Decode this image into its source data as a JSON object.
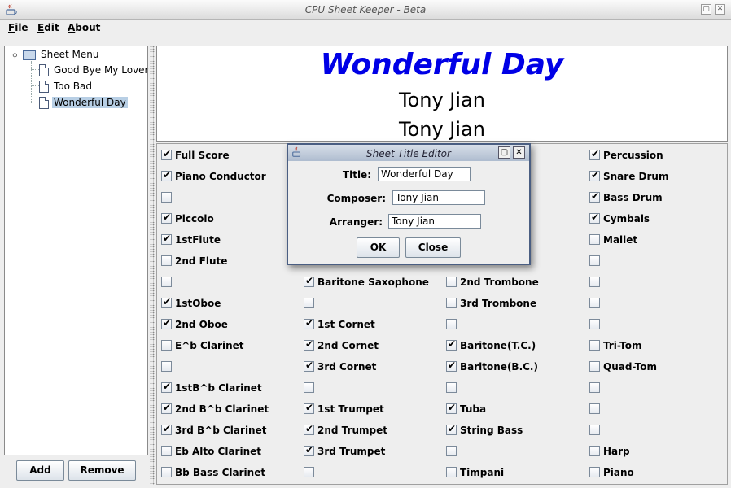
{
  "window": {
    "title": "CPU Sheet Keeper - Beta"
  },
  "menubar": {
    "file": "File",
    "edit": "Edit",
    "about": "About"
  },
  "tree": {
    "root": "Sheet Menu",
    "items": [
      "Good Bye My Lover",
      "Too Bad",
      "Wonderful Day"
    ],
    "selected_index": 2
  },
  "buttons": {
    "add": "Add",
    "remove": "Remove"
  },
  "header": {
    "title": "Wonderful Day",
    "composer": "Tony Jian",
    "arranger": "Tony Jian",
    "title_color": "#0000e6"
  },
  "parts": {
    "col1": [
      {
        "label": "Full Score",
        "checked": true
      },
      {
        "label": "Piano Conductor",
        "checked": true
      },
      {
        "label": "",
        "checked": false
      },
      {
        "label": "Piccolo",
        "checked": true
      },
      {
        "label": "1stFlute",
        "checked": true
      },
      {
        "label": "2nd Flute",
        "checked": false
      },
      {
        "label": "",
        "checked": false
      },
      {
        "label": "1stOboe",
        "checked": true
      },
      {
        "label": "2nd Oboe",
        "checked": true
      },
      {
        "label": "E^b Clarinet",
        "checked": false
      },
      {
        "label": "",
        "checked": false
      },
      {
        "label": "1stB^b Clarinet",
        "checked": true
      },
      {
        "label": "2nd B^b Clarinet",
        "checked": true
      },
      {
        "label": "3rd B^b Clarinet",
        "checked": true
      },
      {
        "label": "Eb Alto Clarinet",
        "checked": false
      },
      {
        "label": "Bb Bass Clarinet",
        "checked": false
      }
    ],
    "col2": [
      {
        "label": "Baritone Saxophone",
        "checked": true
      },
      {
        "label": "",
        "checked": false
      },
      {
        "label": "1st Cornet",
        "checked": true
      },
      {
        "label": "2nd Cornet",
        "checked": true
      },
      {
        "label": "3rd Cornet",
        "checked": true
      },
      {
        "label": "",
        "checked": false
      },
      {
        "label": "1st Trumpet",
        "checked": true
      },
      {
        "label": "2nd Trumpet",
        "checked": true
      },
      {
        "label": "3rd Trumpet",
        "checked": true
      },
      {
        "label": "",
        "checked": false
      }
    ],
    "col3": [
      {
        "label": "2nd Trombone",
        "checked": false
      },
      {
        "label": "3rd Trombone",
        "checked": false
      },
      {
        "label": "",
        "checked": false
      },
      {
        "label": " Baritone(T.C.)",
        "checked": true
      },
      {
        "label": "Baritone(B.C.)",
        "checked": true
      },
      {
        "label": "",
        "checked": false
      },
      {
        "label": "Tuba",
        "checked": true
      },
      {
        "label": "String Bass",
        "checked": true
      },
      {
        "label": "",
        "checked": false
      },
      {
        "label": "Timpani",
        "checked": false
      }
    ],
    "col4": [
      {
        "label": "Percussion",
        "checked": true
      },
      {
        "label": "Snare Drum",
        "checked": true
      },
      {
        "label": "Bass Drum",
        "checked": true
      },
      {
        "label": "Cymbals",
        "checked": true
      },
      {
        "label": "Mallet",
        "checked": false
      },
      {
        "label": "",
        "checked": false
      },
      {
        "label": "",
        "checked": false
      },
      {
        "label": "",
        "checked": false
      },
      {
        "label": "",
        "checked": false
      },
      {
        "label": "Tri-Tom",
        "checked": false
      },
      {
        "label": "Quad-Tom",
        "checked": false
      },
      {
        "label": "",
        "checked": false
      },
      {
        "label": "",
        "checked": false
      },
      {
        "label": "",
        "checked": false
      },
      {
        "label": "Harp",
        "checked": false
      },
      {
        "label": "Piano",
        "checked": false
      }
    ]
  },
  "dialog": {
    "title": "Sheet Title Editor",
    "title_label": "Title:",
    "title_value": "Wonderful Day",
    "composer_label": "Composer:",
    "composer_value": "Tony Jian",
    "arranger_label": "Arranger:",
    "arranger_value": "Tony Jian",
    "ok": "OK",
    "close": "Close"
  }
}
